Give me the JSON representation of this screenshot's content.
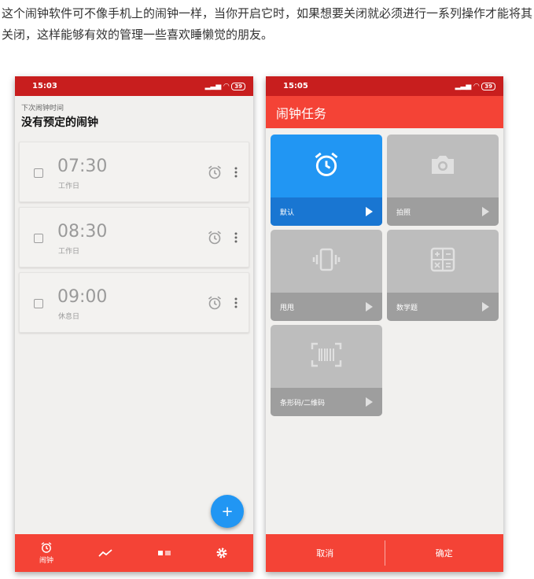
{
  "intro_text": "这个闹钟软件可不像手机上的闹钟一样，当你开启它时，如果想要关闭就必须进行一系列操作才能将其关闭，这样能够有效的管理一些喜欢睡懒觉的朋友。",
  "left_screen": {
    "status_time": "15:03",
    "battery": "39",
    "next_alarm_label": "下次闹钟时间",
    "next_alarm_value": "没有预定的闹钟",
    "alarms": [
      {
        "time": "07:30",
        "days": "工作日",
        "enabled": false
      },
      {
        "time": "08:30",
        "days": "工作日",
        "enabled": false
      },
      {
        "time": "09:00",
        "days": "休息日",
        "enabled": false
      }
    ],
    "fab_label": "+",
    "nav": {
      "alarm_label": "闹钟"
    }
  },
  "right_screen": {
    "status_time": "15:05",
    "battery": "39",
    "title": "闹钟任务",
    "tasks": [
      {
        "label": "默认",
        "icon": "alarm-clock-icon",
        "active": true
      },
      {
        "label": "拍照",
        "icon": "camera-icon",
        "active": false
      },
      {
        "label": "甩甩",
        "icon": "vibrate-phone-icon",
        "active": false
      },
      {
        "label": "数学题",
        "icon": "calculator-icon",
        "active": false
      },
      {
        "label": "条形码/二维码",
        "icon": "barcode-icon",
        "active": false
      }
    ],
    "cancel_label": "取消",
    "confirm_label": "确定"
  },
  "colors": {
    "status_bar": "#c81e1e",
    "accent_red": "#f44336",
    "active_blue": "#2196f3",
    "tile_grey": "#bdbdbd"
  }
}
